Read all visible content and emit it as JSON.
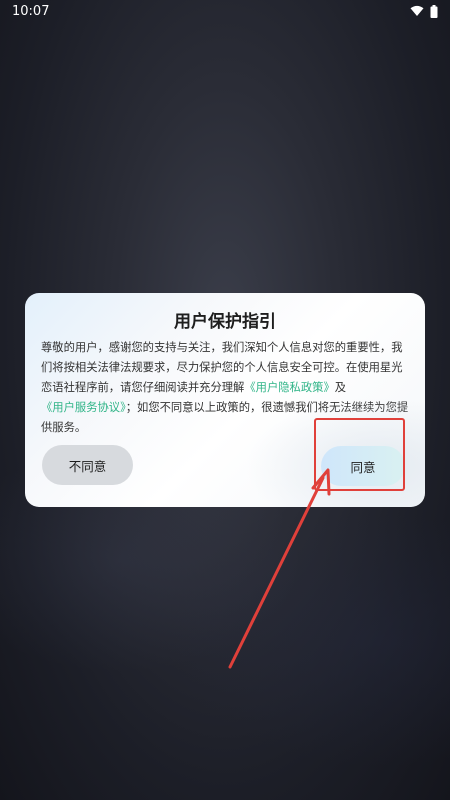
{
  "status_bar": {
    "time": "10:07",
    "icons": [
      "wifi-icon",
      "battery-icon"
    ]
  },
  "dialog": {
    "title": "用户保护指引",
    "body_intro": "尊敬的用户，感谢您的支持与关注，我们深知个人信息对您的重要性，我们将按相关法律法规要求，尽力保护您的个人信息安全可控。在使用星光恋语社程序前，请您仔细阅读并充分理解",
    "privacy_policy_link": "《用户隐私政策》",
    "conjunction": "及",
    "service_agreement_link": "《用户服务协议》",
    "body_outro": "；如您不同意以上政策的，很遗憾我们将无法继续为您提供服务。",
    "decline_label": "不同意",
    "agree_label": "同意"
  },
  "colors": {
    "link": "#2fb487",
    "annotation": "#e0403a",
    "background": "#1c1e27"
  }
}
